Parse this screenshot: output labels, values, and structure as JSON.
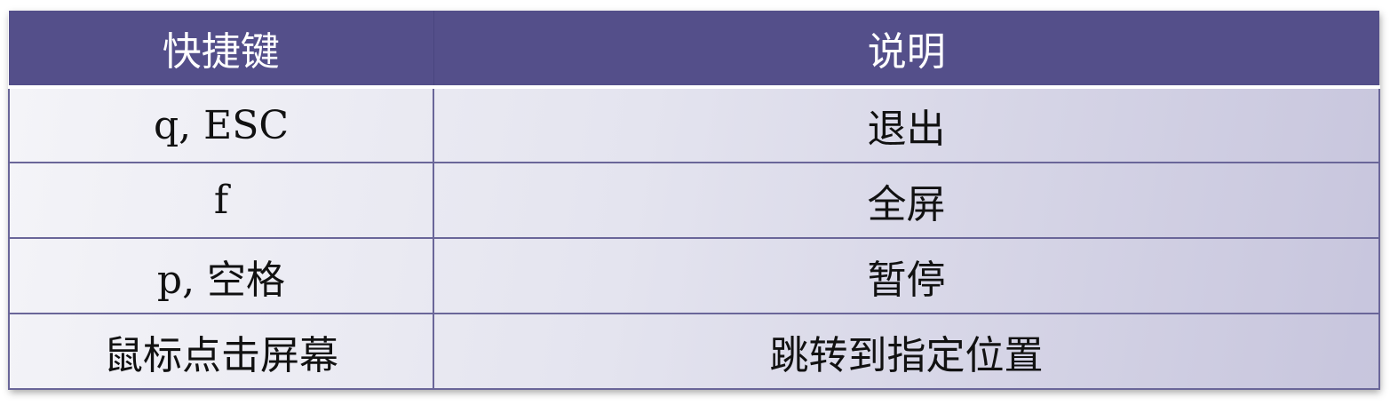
{
  "table": {
    "headers": [
      "快捷键",
      "说明"
    ],
    "rows": [
      {
        "key": "q, ESC",
        "description": "退出"
      },
      {
        "key": "f",
        "description": "全屏"
      },
      {
        "key": "p, 空格",
        "description": "暂停"
      },
      {
        "key": "鼠标点击屏幕",
        "description": "跳转到指定位置"
      }
    ]
  },
  "colors": {
    "header_bg": "#544f8a",
    "header_text": "#ffffff",
    "body_gradient_start": "#f4f4f8",
    "body_gradient_end": "#c7c5dd",
    "grid_line": "#6a6699"
  }
}
